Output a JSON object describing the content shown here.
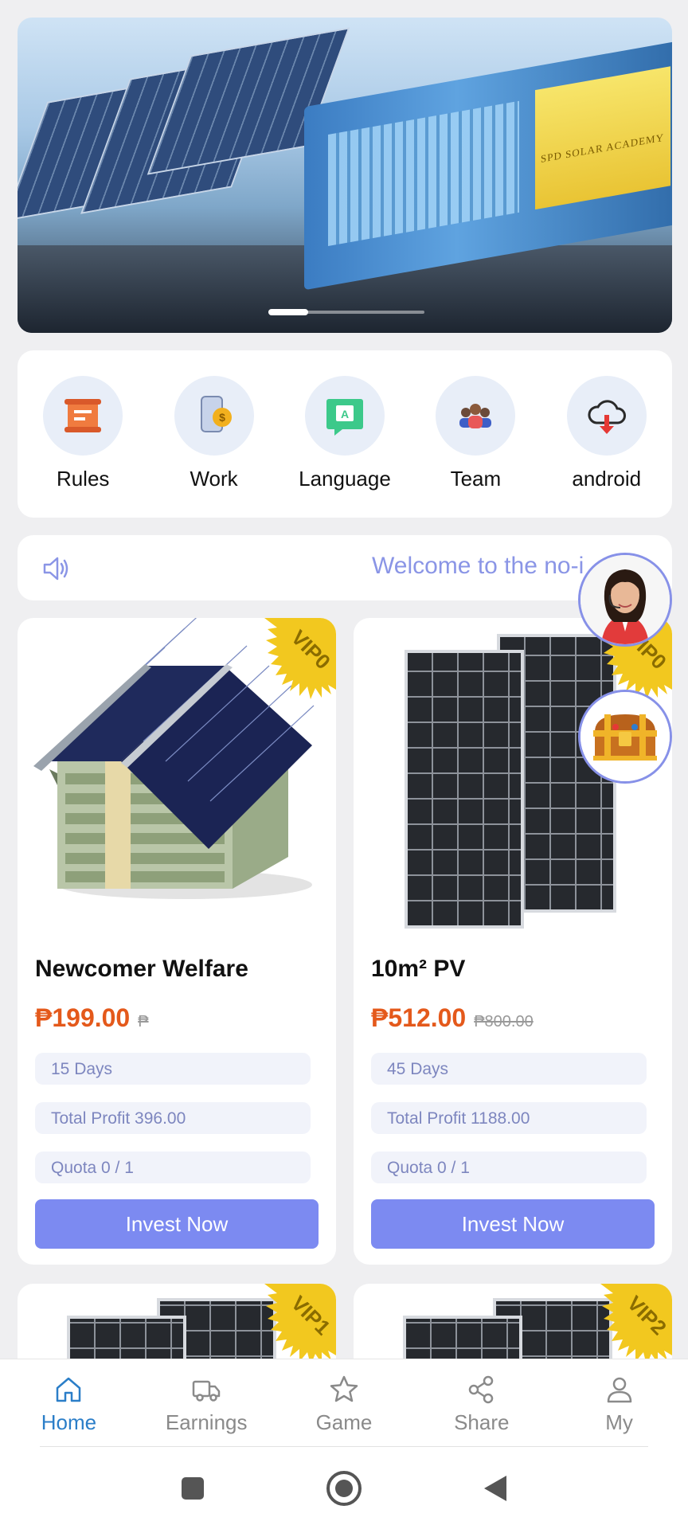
{
  "banner": {
    "sign_text": "SPD SOLAR ACADEMY",
    "slide_index": 1,
    "slide_count": 4
  },
  "quick_menu": [
    {
      "label": "Rules",
      "icon": "scroll-icon"
    },
    {
      "label": "Work",
      "icon": "phone-coin-icon"
    },
    {
      "label": "Language",
      "icon": "language-icon"
    },
    {
      "label": "Team",
      "icon": "team-icon"
    },
    {
      "label": "android",
      "icon": "cloud-download-icon"
    }
  ],
  "notice": {
    "icon": "speaker-icon",
    "text": "Welcome to the no-i"
  },
  "products": [
    {
      "vip": "VIP0",
      "title": "Newcomer Welfare",
      "price": "₱199.00",
      "original_price": "₱",
      "days": "15 Days",
      "profit": "Total Profit 396.00",
      "quota": "Quota 0 / 1",
      "button": "Invest Now"
    },
    {
      "vip": "VIP0",
      "title": "10m² PV",
      "price": "₱512.00",
      "original_price": "₱800.00",
      "days": "45 Days",
      "profit": "Total Profit 1188.00",
      "quota": "Quota 0 / 1",
      "button": "Invest Now"
    },
    {
      "vip": "VIP1"
    },
    {
      "vip": "VIP2"
    }
  ],
  "floating": {
    "support": "customer-service-avatar",
    "gift": "treasure-chest-icon"
  },
  "bottom_nav": [
    {
      "label": "Home",
      "icon": "home-icon",
      "active": true
    },
    {
      "label": "Earnings",
      "icon": "truck-icon",
      "active": false
    },
    {
      "label": "Game",
      "icon": "star-icon",
      "active": false
    },
    {
      "label": "Share",
      "icon": "share-icon",
      "active": false
    },
    {
      "label": "My",
      "icon": "user-icon",
      "active": false
    }
  ],
  "colors": {
    "accent": "#7c8af1",
    "price": "#e4591b",
    "nav_active": "#2b7ec8",
    "notice_text": "#8a95e6"
  }
}
